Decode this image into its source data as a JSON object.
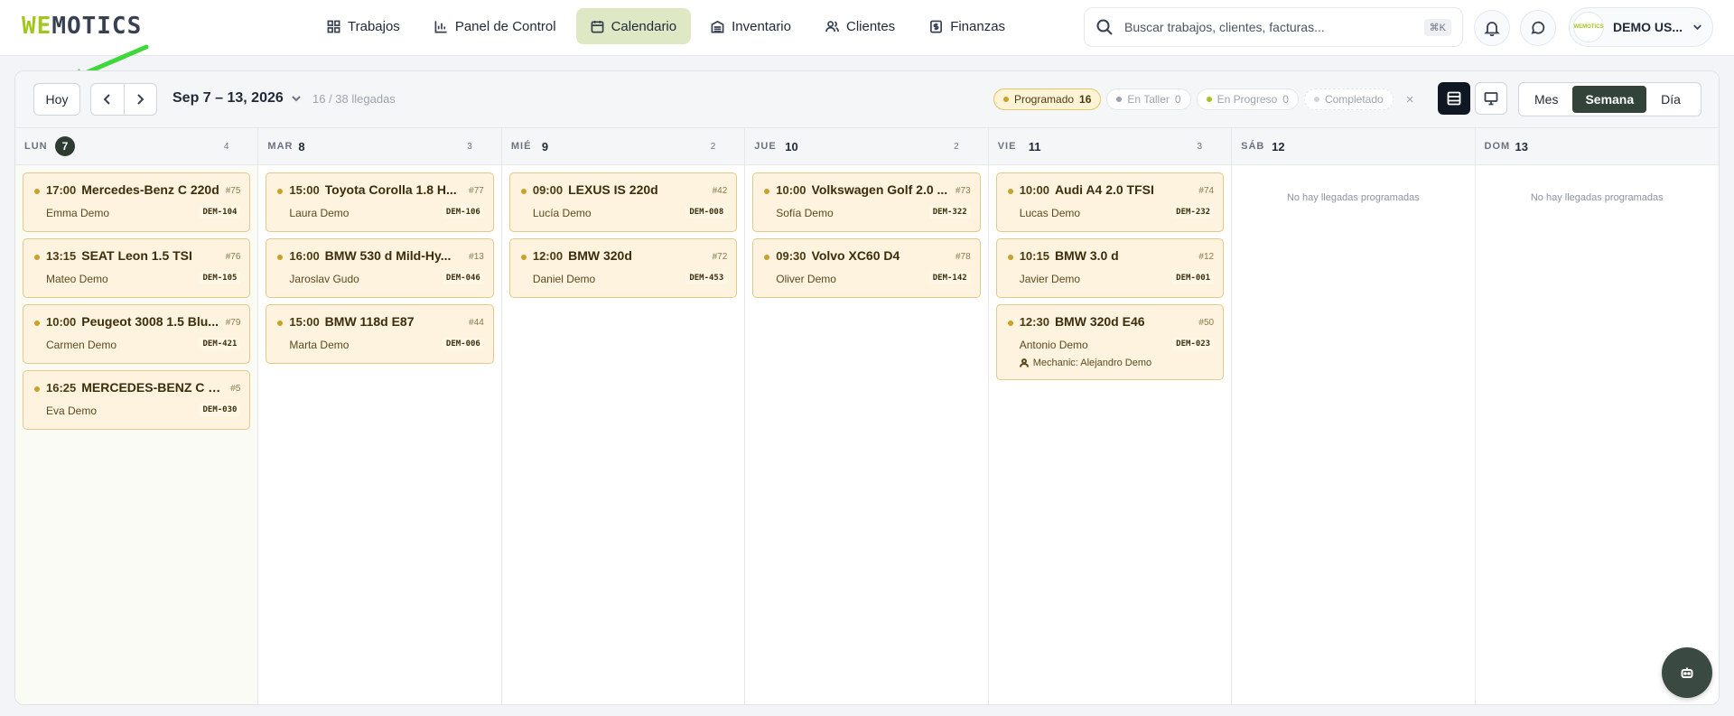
{
  "brand": {
    "logo_accent": "WE",
    "logo_rest": "MOTICS"
  },
  "nav": [
    {
      "label": "Trabajos",
      "icon": "grid-icon"
    },
    {
      "label": "Panel de Control",
      "icon": "bar-chart-icon"
    },
    {
      "label": "Calendario",
      "icon": "calendar-icon",
      "active": true
    },
    {
      "label": "Inventario",
      "icon": "inventory-icon"
    },
    {
      "label": "Clientes",
      "icon": "users-icon"
    },
    {
      "label": "Finanzas",
      "icon": "dollar-icon"
    }
  ],
  "search": {
    "placeholder": "Buscar trabajos, clientes, facturas...",
    "shortcut": "⌘K"
  },
  "user": {
    "name": "DEMO US...",
    "avatar_text": "WEMOTICS"
  },
  "toolbar": {
    "today": "Hoy",
    "range": "Sep 7 – 13, 2026",
    "arrivals": "16 / 38 llegadas",
    "filters": [
      {
        "label": "Programado",
        "count": "16",
        "color": "#c9a227",
        "active": true
      },
      {
        "label": "En Taller",
        "count": "0",
        "color": "#9ca3af"
      },
      {
        "label": "En Progreso",
        "count": "0",
        "color": "#a3c520"
      },
      {
        "label": "Completado",
        "count": "",
        "color": "#d1d5db"
      }
    ],
    "clear": "×",
    "views": [
      "Mes",
      "Semana",
      "Día"
    ],
    "active_view": "Semana"
  },
  "empty_text": "No hay llegadas programadas",
  "days": [
    {
      "name": "LUN",
      "num": "7",
      "count": "4",
      "today": true,
      "cards": [
        {
          "time": "17:00",
          "model": "Mercedes-Benz C 220d",
          "num": "#75",
          "client": "Emma Demo",
          "plate": "DEM-104"
        },
        {
          "time": "13:15",
          "model": "SEAT Leon 1.5 TSI",
          "num": "#76",
          "client": "Mateo Demo",
          "plate": "DEM-105"
        },
        {
          "time": "10:00",
          "model": "Peugeot 3008 1.5 Blu...",
          "num": "#79",
          "client": "Carmen Demo",
          "plate": "DEM-421"
        },
        {
          "time": "16:25",
          "model": "MERCEDES-BENZ C 35...",
          "num": "#5",
          "client": "Eva Demo",
          "plate": "DEM-030"
        }
      ]
    },
    {
      "name": "MAR",
      "num": "8",
      "count": "3",
      "cards": [
        {
          "time": "15:00",
          "model": "Toyota Corolla 1.8 H...",
          "num": "#77",
          "client": "Laura Demo",
          "plate": "DEM-106"
        },
        {
          "time": "16:00",
          "model": "BMW 530 d Mild-Hy...",
          "num": "#13",
          "client": "Jaroslav Gudo",
          "plate": "DEM-046"
        },
        {
          "time": "15:00",
          "model": "BMW 118d E87",
          "num": "#44",
          "client": "Marta Demo",
          "plate": "DEM-006"
        }
      ]
    },
    {
      "name": "MIÉ",
      "num": "9",
      "count": "2",
      "cards": [
        {
          "time": "09:00",
          "model": "LEXUS IS 220d",
          "num": "#42",
          "client": "Lucía Demo",
          "plate": "DEM-008"
        },
        {
          "time": "12:00",
          "model": "BMW 320d",
          "num": "#72",
          "client": "Daniel Demo",
          "plate": "DEM-453"
        }
      ]
    },
    {
      "name": "JUE",
      "num": "10",
      "count": "2",
      "cards": [
        {
          "time": "10:00",
          "model": "Volkswagen Golf 2.0 ...",
          "num": "#73",
          "client": "Sofía Demo",
          "plate": "DEM-322"
        },
        {
          "time": "09:30",
          "model": "Volvo XC60 D4",
          "num": "#78",
          "client": "Oliver Demo",
          "plate": "DEM-142"
        }
      ]
    },
    {
      "name": "VIE",
      "num": "11",
      "count": "3",
      "cards": [
        {
          "time": "10:00",
          "model": "Audi A4 2.0 TFSI",
          "num": "#74",
          "client": "Lucas Demo",
          "plate": "DEM-232"
        },
        {
          "time": "10:15",
          "model": "BMW 3.0 d",
          "num": "#12",
          "client": "Javier Demo",
          "plate": "DEM-001"
        },
        {
          "time": "12:30",
          "model": "BMW 320d E46",
          "num": "#50",
          "client": "Antonio Demo",
          "plate": "DEM-023",
          "mechanic": "Mechanic: Alejandro Demo"
        }
      ]
    },
    {
      "name": "SÁB",
      "num": "12",
      "count": "",
      "cards": []
    },
    {
      "name": "DOM",
      "num": "13",
      "count": "",
      "cards": []
    }
  ]
}
